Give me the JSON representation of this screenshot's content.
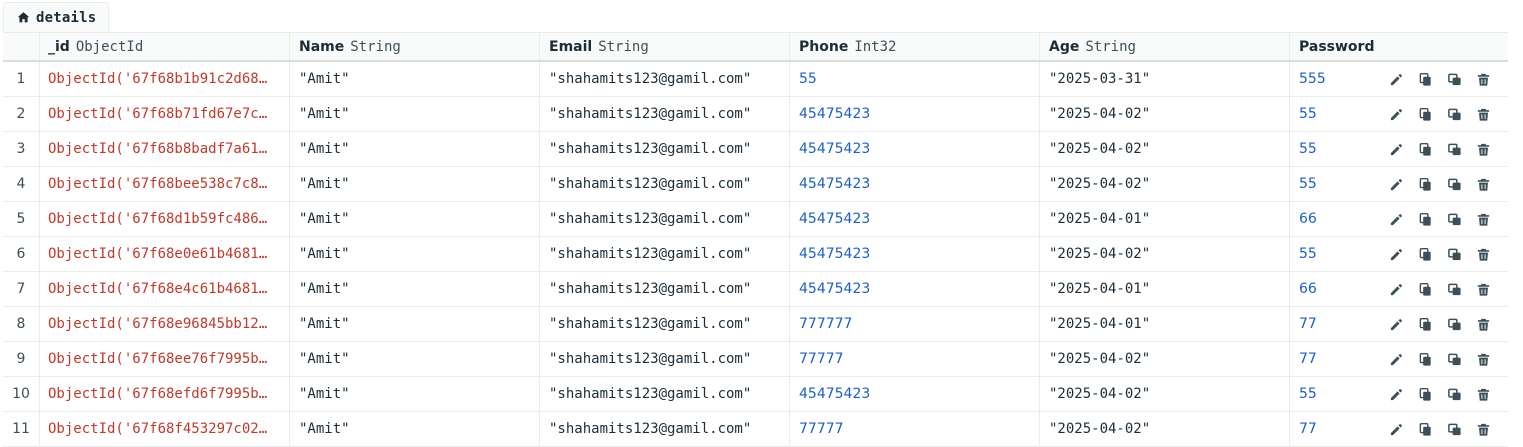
{
  "tab": {
    "label": "details",
    "icon": "home-icon"
  },
  "columns": [
    {
      "key": "_id",
      "name": "_id",
      "type": "ObjectId"
    },
    {
      "key": "name",
      "name": "Name",
      "type": "String"
    },
    {
      "key": "email",
      "name": "Email",
      "type": "String"
    },
    {
      "key": "phone",
      "name": "Phone",
      "type": "Int32"
    },
    {
      "key": "age",
      "name": "Age",
      "type": "String"
    },
    {
      "key": "password",
      "name": "Password",
      "type": ""
    }
  ],
  "row_actions": [
    "edit-icon",
    "copy-icon",
    "clone-icon",
    "delete-icon"
  ],
  "colors": {
    "objectid": "#c0392b",
    "number": "#1a5fc9",
    "string": "#1c2d38"
  },
  "rows": [
    {
      "num": "1",
      "id": "ObjectId('67f68b1b91c2d68…",
      "name": "\"Amit\"",
      "email": "\"shahamits123@gamil.com\"",
      "phone": "55",
      "age": "\"2025-03-31\"",
      "password": "555"
    },
    {
      "num": "2",
      "id": "ObjectId('67f68b71fd67e7c…",
      "name": "\"Amit\"",
      "email": "\"shahamits123@gamil.com\"",
      "phone": "45475423",
      "age": "\"2025-04-02\"",
      "password": "55"
    },
    {
      "num": "3",
      "id": "ObjectId('67f68b8badf7a61…",
      "name": "\"Amit\"",
      "email": "\"shahamits123@gamil.com\"",
      "phone": "45475423",
      "age": "\"2025-04-02\"",
      "password": "55"
    },
    {
      "num": "4",
      "id": "ObjectId('67f68bee538c7c8…",
      "name": "\"Amit\"",
      "email": "\"shahamits123@gamil.com\"",
      "phone": "45475423",
      "age": "\"2025-04-02\"",
      "password": "55"
    },
    {
      "num": "5",
      "id": "ObjectId('67f68d1b59fc486…",
      "name": "\"Amit\"",
      "email": "\"shahamits123@gamil.com\"",
      "phone": "45475423",
      "age": "\"2025-04-01\"",
      "password": "66"
    },
    {
      "num": "6",
      "id": "ObjectId('67f68e0e61b4681…",
      "name": "\"Amit\"",
      "email": "\"shahamits123@gamil.com\"",
      "phone": "45475423",
      "age": "\"2025-04-02\"",
      "password": "55"
    },
    {
      "num": "7",
      "id": "ObjectId('67f68e4c61b4681…",
      "name": "\"Amit\"",
      "email": "\"shahamits123@gamil.com\"",
      "phone": "45475423",
      "age": "\"2025-04-01\"",
      "password": "66"
    },
    {
      "num": "8",
      "id": "ObjectId('67f68e96845bb12…",
      "name": "\"Amit\"",
      "email": "\"shahamits123@gamil.com\"",
      "phone": "777777",
      "age": "\"2025-04-01\"",
      "password": "77"
    },
    {
      "num": "9",
      "id": "ObjectId('67f68ee76f7995b…",
      "name": "\"Amit\"",
      "email": "\"shahamits123@gamil.com\"",
      "phone": "77777",
      "age": "\"2025-04-02\"",
      "password": "77"
    },
    {
      "num": "10",
      "id": "ObjectId('67f68efd6f7995b…",
      "name": "\"Amit\"",
      "email": "\"shahamits123@gamil.com\"",
      "phone": "45475423",
      "age": "\"2025-04-02\"",
      "password": "55"
    },
    {
      "num": "11",
      "id": "ObjectId('67f68f453297c02…",
      "name": "\"Amit\"",
      "email": "\"shahamits123@gamil.com\"",
      "phone": "77777",
      "age": "\"2025-04-02\"",
      "password": "77"
    }
  ]
}
